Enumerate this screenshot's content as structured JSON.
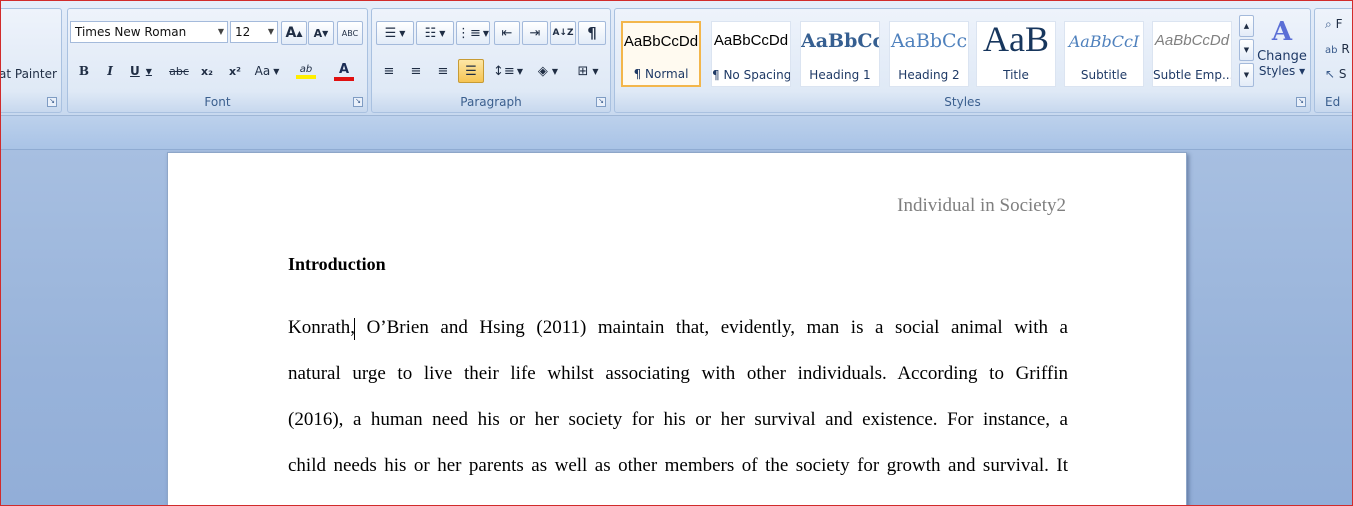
{
  "clipboard": {
    "format_painter_label": "at Painter"
  },
  "font": {
    "group_label": "Font",
    "font_name": "Times New Roman",
    "font_size": "12",
    "grow_font": "A",
    "shrink_font": "A",
    "clear_format": "ABC",
    "bold": "B",
    "italic": "I",
    "underline": "U",
    "strikethrough": "abc",
    "subscript": "x₂",
    "superscript": "x²",
    "change_case": "Aa",
    "highlight": "ab",
    "font_color": "A",
    "highlight_color": "#ffee00",
    "font_color_value": "#e01010"
  },
  "paragraph": {
    "group_label": "Paragraph",
    "show_marks": "¶",
    "sort": "A↓Z"
  },
  "styles": {
    "group_label": "Styles",
    "tiles": [
      {
        "sample": "AaBbCcDd",
        "name": "¶ Normal"
      },
      {
        "sample": "AaBbCcDd",
        "name": "¶ No Spacing"
      },
      {
        "sample": "AaBbCc",
        "name": "Heading 1"
      },
      {
        "sample": "AaBbCc",
        "name": "Heading 2"
      },
      {
        "sample": "AaB",
        "name": "Title"
      },
      {
        "sample": "AaBbCcI",
        "name": "Subtitle"
      },
      {
        "sample": "AaBbCcDd",
        "name": "Subtle Emp..."
      }
    ],
    "change_styles_line1": "Change",
    "change_styles_line2": "Styles ▾"
  },
  "editing": {
    "group_label": "Ed",
    "find": "F",
    "replace": "R",
    "select": "S"
  },
  "document": {
    "header": "Individual in Society2",
    "heading": "Introduction",
    "lines": [
      "Konrath, O’Brien and Hsing (2011) maintain that, evidently, man is a social animal with a",
      "natural urge to live their life whilst associating with other individuals. According to Griffin",
      "(2016), a human need his or her society for his or her survival and existence. For instance, a",
      "child needs his or her parents as well as other members of the society for growth and survival. It"
    ]
  }
}
